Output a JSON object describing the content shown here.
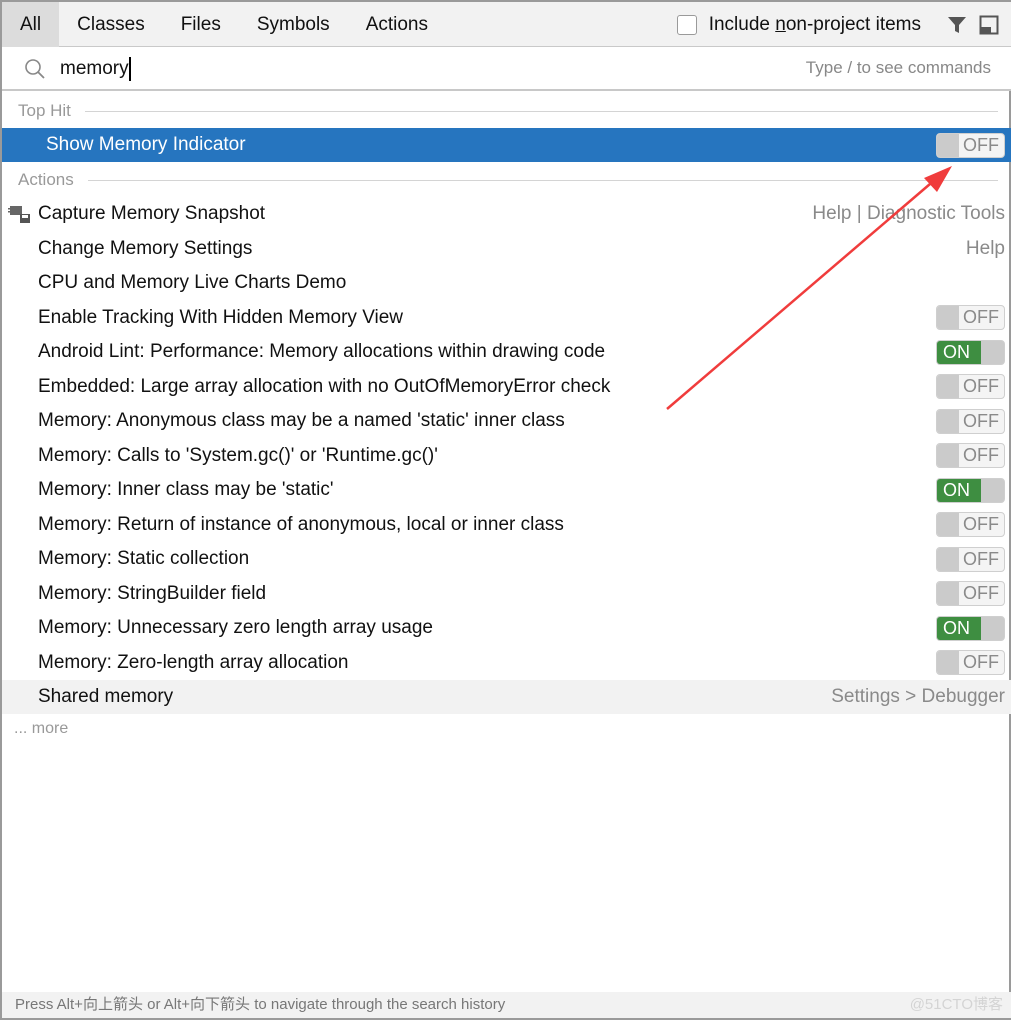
{
  "tabs": [
    "All",
    "Classes",
    "Files",
    "Symbols",
    "Actions"
  ],
  "selected_tab": "All",
  "include_checkbox": {
    "label_pre": "Include ",
    "label_u": "n",
    "label_post": "on-project items",
    "checked": false
  },
  "search": {
    "value": "memory",
    "hint": "Type / to see commands"
  },
  "sections": {
    "top_hit": "Top Hit",
    "actions": "Actions"
  },
  "top_hit": {
    "label": "Show Memory Indicator",
    "toggle": "OFF"
  },
  "rows": [
    {
      "label": "Capture Memory Snapshot",
      "right": "Help | Diagnostic Tools",
      "icon": "memory-snapshot-icon"
    },
    {
      "label": "Change Memory Settings",
      "right": "Help"
    },
    {
      "label": "CPU and Memory Live Charts Demo"
    },
    {
      "label": "Enable Tracking With Hidden Memory View",
      "toggle": "OFF"
    },
    {
      "label": "Android Lint: Performance: Memory allocations within drawing code",
      "toggle": "ON"
    },
    {
      "label": "Embedded: Large array allocation with no OutOfMemoryError check",
      "toggle": "OFF"
    },
    {
      "label": "Memory: Anonymous class may be a named 'static' inner class",
      "toggle": "OFF"
    },
    {
      "label": "Memory: Calls to 'System.gc()' or 'Runtime.gc()'",
      "toggle": "OFF"
    },
    {
      "label": "Memory: Inner class may be 'static'",
      "toggle": "ON"
    },
    {
      "label": "Memory: Return of instance of anonymous, local or inner class",
      "toggle": "OFF"
    },
    {
      "label": "Memory: Static collection",
      "toggle": "OFF"
    },
    {
      "label": "Memory: StringBuilder field",
      "toggle": "OFF"
    },
    {
      "label": "Memory: Unnecessary zero length array usage",
      "toggle": "ON"
    },
    {
      "label": "Memory: Zero-length array allocation",
      "toggle": "OFF"
    },
    {
      "label": "Shared memory",
      "right": "Settings > Debugger"
    }
  ],
  "more": "... more",
  "footer": "Press Alt+向上箭头 or Alt+向下箭头 to navigate through the search history",
  "watermark": "@51CTO博客",
  "colors": {
    "selection": "#2675bf",
    "toggle_on": "#3e8e41",
    "annotation_arrow": "#f03c3c"
  }
}
